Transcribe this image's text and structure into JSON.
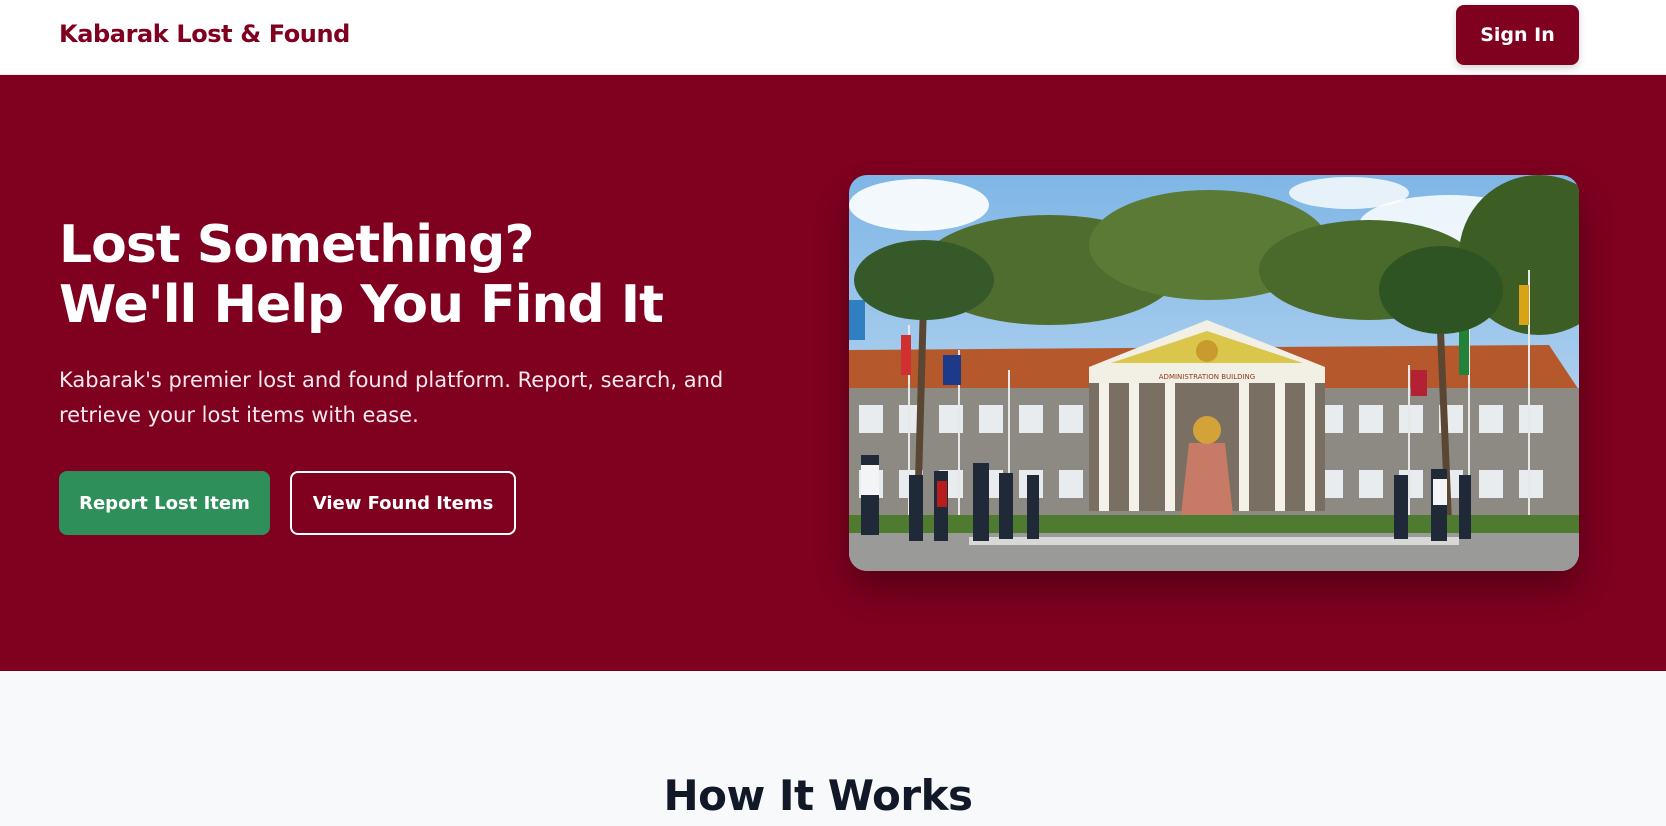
{
  "navbar": {
    "brand": "Kabarak Lost & Found",
    "signin_label": "Sign In"
  },
  "hero": {
    "title_line1": "Lost Something?",
    "title_line2": "We'll Help You Find It",
    "subtitle": "Kabarak's premier lost and found platform. Report, search, and retrieve your lost items with ease.",
    "report_label": "Report Lost Item",
    "found_label": "View Found Items",
    "image_alt": "Kabarak University administration building",
    "building_sign": "ADMINISTRATION BUILDING"
  },
  "how_it_works": {
    "title": "How It Works"
  },
  "colors": {
    "brand": "#800020",
    "success": "#2f8f5b",
    "page_bg": "#f8f9fb"
  }
}
